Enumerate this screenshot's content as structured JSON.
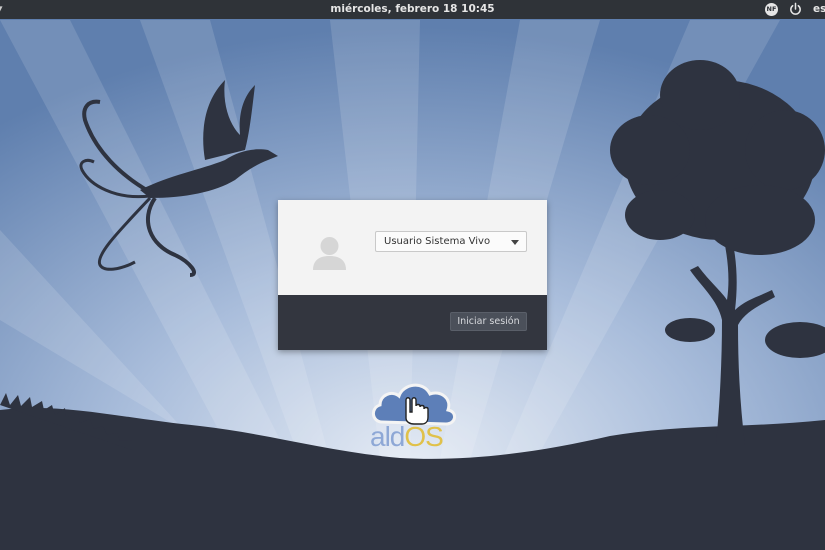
{
  "topbar": {
    "clock": "miércoles, febrero 18  10:45",
    "keyboard_badge": "NF",
    "language": "es",
    "menu_glyph": "▾"
  },
  "login": {
    "selected_user": "Usuario Sistema Vivo",
    "login_button": "Iniciar sesión"
  },
  "branding": {
    "name_part1": "ald",
    "name_part2": "OS"
  },
  "icons": [
    "menu-icon",
    "keyboard-layout-icon",
    "power-icon",
    "user-avatar-icon",
    "dropdown-arrow-icon",
    "cloud-hand-logo-icon"
  ],
  "colors": {
    "topbar": "#2f3338",
    "sky_light": "#c9d6ea",
    "sky_dark": "#5f7fae",
    "silhouette": "#2e3340",
    "card_top": "#f3f3f3",
    "card_bottom": "#33363f",
    "logo_blue": "#8ea8d6",
    "logo_gold": "#e0c14a"
  }
}
